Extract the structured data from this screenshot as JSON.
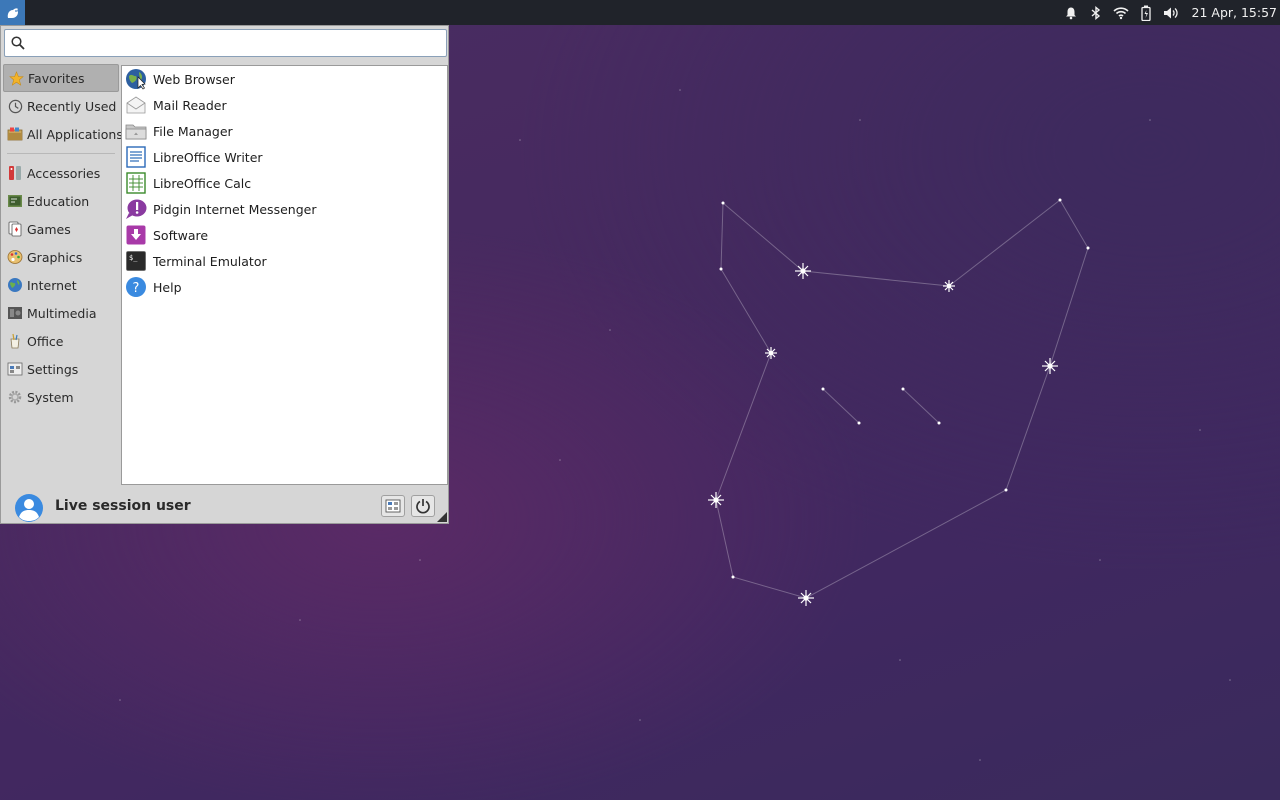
{
  "panel": {
    "clock": "21 Apr, 15:57",
    "tray_icons": [
      "bell-icon",
      "bluetooth-icon",
      "wifi-icon",
      "battery-icon",
      "volume-icon"
    ]
  },
  "menu": {
    "search": {
      "value": "",
      "placeholder": ""
    },
    "categories": [
      {
        "label": "Favorites",
        "icon": "star-icon",
        "active": true
      },
      {
        "label": "Recently Used",
        "icon": "clock-icon",
        "active": false
      },
      {
        "label": "All Applications",
        "icon": "apps-folder-icon",
        "active": false
      },
      {
        "label": "Accessories",
        "icon": "accessories-icon",
        "active": false
      },
      {
        "label": "Education",
        "icon": "education-icon",
        "active": false
      },
      {
        "label": "Games",
        "icon": "games-icon",
        "active": false
      },
      {
        "label": "Graphics",
        "icon": "graphics-icon",
        "active": false
      },
      {
        "label": "Internet",
        "icon": "globe-icon",
        "active": false
      },
      {
        "label": "Multimedia",
        "icon": "multimedia-icon",
        "active": false
      },
      {
        "label": "Office",
        "icon": "office-icon",
        "active": false
      },
      {
        "label": "Settings",
        "icon": "settings-icon",
        "active": false
      },
      {
        "label": "System",
        "icon": "system-gear-icon",
        "active": false
      }
    ],
    "apps": [
      {
        "label": "Web Browser",
        "icon": "web-browser-icon"
      },
      {
        "label": "Mail Reader",
        "icon": "mail-icon"
      },
      {
        "label": "File Manager",
        "icon": "folder-icon"
      },
      {
        "label": "LibreOffice Writer",
        "icon": "writer-icon"
      },
      {
        "label": "LibreOffice Calc",
        "icon": "calc-icon"
      },
      {
        "label": "Pidgin Internet Messenger",
        "icon": "pidgin-icon"
      },
      {
        "label": "Software",
        "icon": "software-icon"
      },
      {
        "label": "Terminal Emulator",
        "icon": "terminal-icon"
      },
      {
        "label": "Help",
        "icon": "help-icon"
      }
    ],
    "user": {
      "name": "Live session user"
    }
  },
  "colors": {
    "panel_bg": "#20232a",
    "menu_bg": "#d6d6d6",
    "accent": "#3c78b8",
    "desktop": "#46295f"
  }
}
